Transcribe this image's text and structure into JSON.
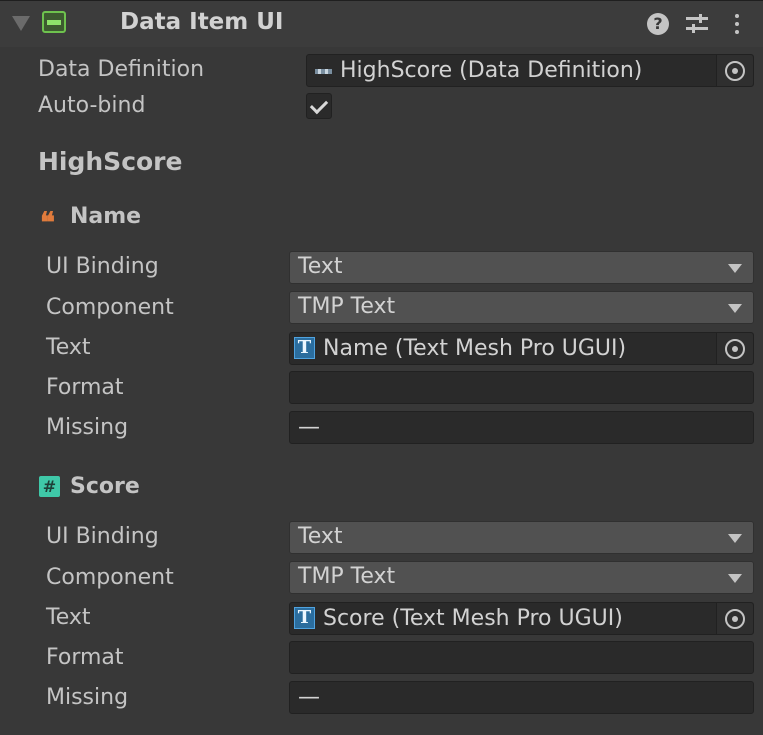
{
  "header": {
    "title": "Data Item UI",
    "help_glyph": "?",
    "icons": [
      "foldout-arrow",
      "component-icon",
      "help-icon",
      "presets-icon",
      "more-icon"
    ]
  },
  "fields": {
    "data_definition_label": "Data Definition",
    "data_definition_value": "HighScore (Data Definition)",
    "auto_bind_label": "Auto-bind",
    "auto_bind_checked": true
  },
  "group_title": "HighScore",
  "sections": [
    {
      "title": "Name",
      "icon": "quote-icon",
      "ui_binding_label": "UI Binding",
      "ui_binding_value": "Text",
      "component_label": "Component",
      "component_value": "TMP Text",
      "text_label": "Text",
      "text_value": "Name (Text Mesh Pro UGUI)",
      "format_label": "Format",
      "format_value": "",
      "missing_label": "Missing",
      "missing_value": "—"
    },
    {
      "title": "Score",
      "icon": "hash-icon",
      "icon_glyph": "#",
      "ui_binding_label": "UI Binding",
      "ui_binding_value": "Text",
      "component_label": "Component",
      "component_value": "TMP Text",
      "text_label": "Text",
      "text_value": "Score (Text Mesh Pro UGUI)",
      "format_label": "Format",
      "format_value": "",
      "missing_label": "Missing",
      "missing_value": "—"
    }
  ],
  "glyphs": {
    "quote": "❝",
    "tmp": "T"
  },
  "colors": {
    "background": "#383838",
    "component_icon": "#6ec24e",
    "quote_icon": "#e07b3c",
    "hash_icon": "#3fc8a8",
    "tmp_icon": "#2b6d9e"
  }
}
